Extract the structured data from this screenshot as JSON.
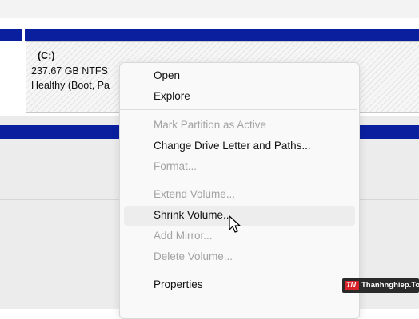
{
  "partition": {
    "name": "(C:)",
    "size_fs": "237.67 GB NTFS",
    "status": "Healthy (Boot, Pa"
  },
  "context_menu": {
    "items": [
      {
        "label": "Open",
        "enabled": true
      },
      {
        "label": "Explore",
        "enabled": true
      },
      {
        "label": "Mark Partition as Active",
        "enabled": false
      },
      {
        "label": "Change Drive Letter and Paths...",
        "enabled": true
      },
      {
        "label": "Format...",
        "enabled": false
      },
      {
        "label": "Extend Volume...",
        "enabled": false
      },
      {
        "label": "Shrink Volume...",
        "enabled": true,
        "hovered": true
      },
      {
        "label": "Add Mirror...",
        "enabled": false
      },
      {
        "label": "Delete Volume...",
        "enabled": false
      },
      {
        "label": "Properties",
        "enabled": true
      }
    ]
  },
  "watermark": {
    "logo": "TN",
    "text": "Thanhnghiep.Top"
  },
  "colors": {
    "volume_bar": "#0a1f9e",
    "menu_background": "#f9f9f9",
    "disabled_text": "#a3a3a3"
  }
}
